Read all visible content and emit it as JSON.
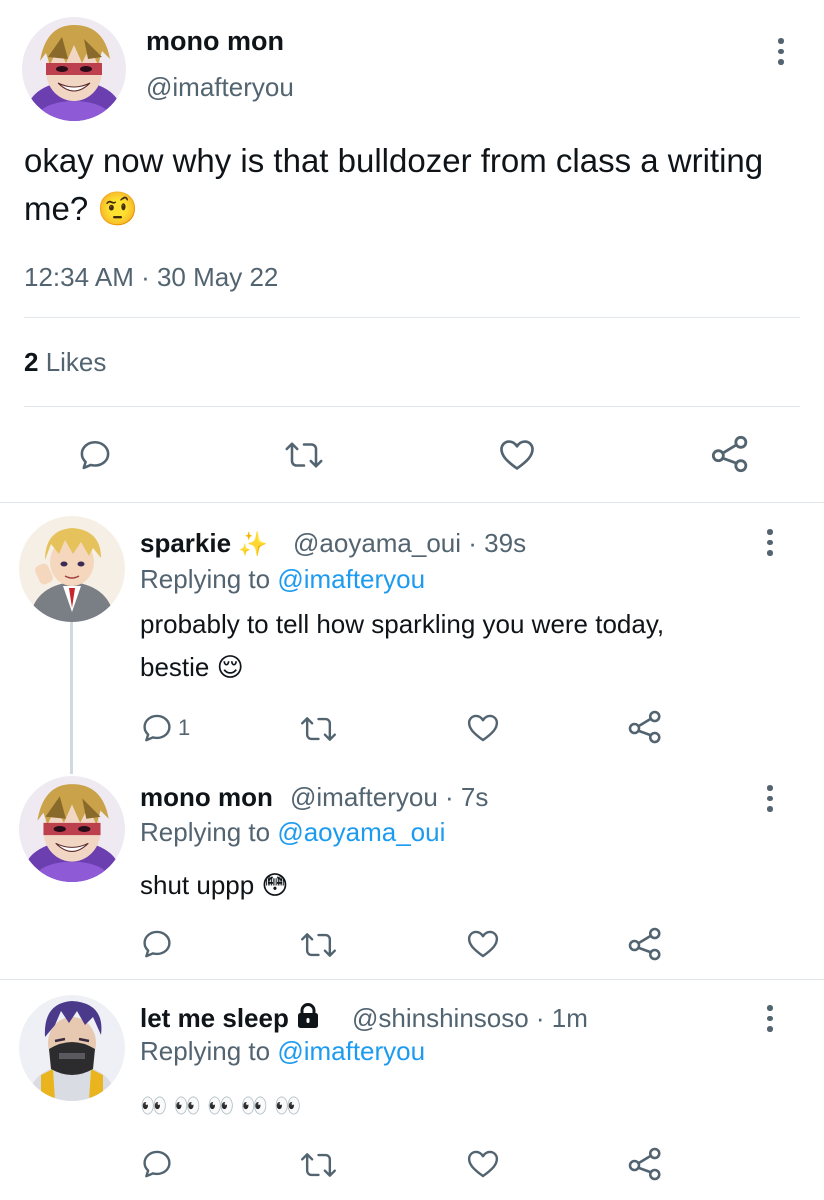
{
  "main_tweet": {
    "display_name": "mono mon",
    "handle": "@imafteryou",
    "text": "okay now why is that bulldozer from class a writing me? 🤨",
    "timestamp": "12:34 AM · 30 May 22",
    "likes_count": "2",
    "likes_label": " Likes"
  },
  "replies": [
    {
      "display_name": "sparkie",
      "name_emoji": "✨",
      "meta": "@aoyama_oui · 39s",
      "replying_prefix": "Replying to ",
      "replying_to": "@imafteryou",
      "text_line1": "probably to tell how sparkling you were today,",
      "text_line2": "bestie 😌",
      "reply_count": "1"
    },
    {
      "display_name": "mono mon",
      "meta": "@imafteryou · 7s",
      "replying_prefix": "Replying to ",
      "replying_to": "@aoyama_oui",
      "text_line1": "shut uppp 😳"
    },
    {
      "display_name": "let me sleep",
      "name_emoji": "🔒",
      "meta": "@shinshinsoso · 1m",
      "replying_prefix": "Replying to ",
      "replying_to": "@imafteryou",
      "text_line1": "👀 👀 👀 👀 👀"
    }
  ],
  "icons": {
    "reply": "reply-bubble-icon",
    "retweet": "retweet-icon",
    "like": "heart-icon",
    "share": "share-icon",
    "more": "more-vertical-icon",
    "lock": "lock-icon"
  },
  "colors": {
    "link": "#1d9bf0",
    "secondary_text": "#536471",
    "primary_text": "#0f1419",
    "divider": "#e1e6ea",
    "thread_line": "#cfd9de"
  }
}
